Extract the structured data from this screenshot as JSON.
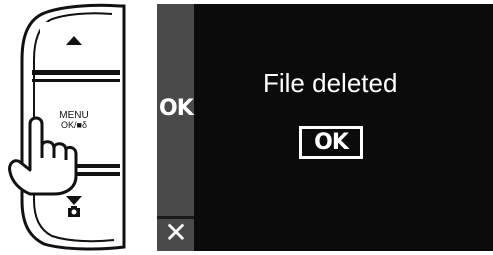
{
  "device": {
    "menu_label_line1": "MENU",
    "menu_label_line2": "OK/■δ",
    "up_icon": "triangle-up-icon",
    "down_icon": "triangle-down-icon",
    "camera_icon": "camera-icon",
    "hand_icon": "pointing-hand-icon"
  },
  "screen": {
    "message": "File deleted",
    "ok_button_label": "OK",
    "side_ok_label": "OK",
    "side_cancel_icon": "close-icon",
    "cancel_label": "✕"
  },
  "colors": {
    "screen_background": "#0b0b0b",
    "side_rail": "#4a4a4a",
    "text": "#ffffff"
  }
}
